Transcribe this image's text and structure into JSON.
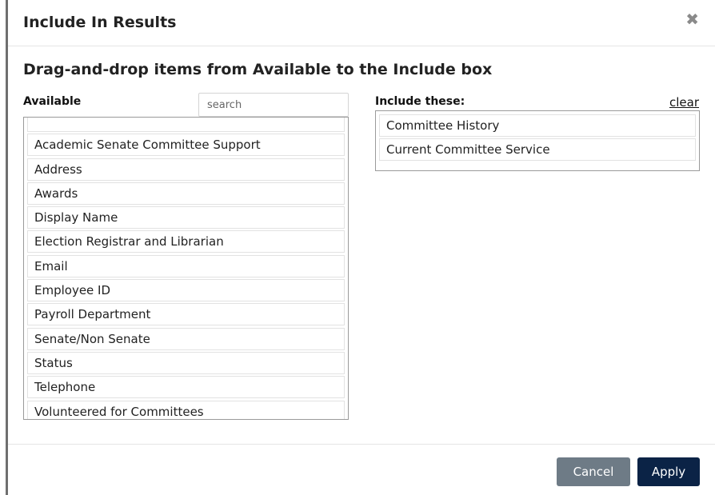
{
  "modal": {
    "title": "Include In Results",
    "close_glyph": "✖",
    "instruction": "Drag-and-drop items from Available to the Include box"
  },
  "available": {
    "label": "Available",
    "search_placeholder": "search",
    "items": [
      "Academic Senate Committee Support",
      "Address",
      "Awards",
      "Display Name",
      "Election Registrar and Librarian",
      "Email",
      "Employee ID",
      "Payroll Department",
      "Senate/Non Senate",
      "Status",
      "Telephone",
      "Volunteered for Committees"
    ]
  },
  "include": {
    "label": "Include these:",
    "clear_label": "clear",
    "items": [
      "Committee History",
      "Current Committee Service"
    ]
  },
  "footer": {
    "cancel_label": "Cancel",
    "apply_label": "Apply"
  },
  "colors": {
    "apply_bg": "#0b2346",
    "cancel_bg": "#6e7b86",
    "box_border": "#9a9a9a"
  }
}
